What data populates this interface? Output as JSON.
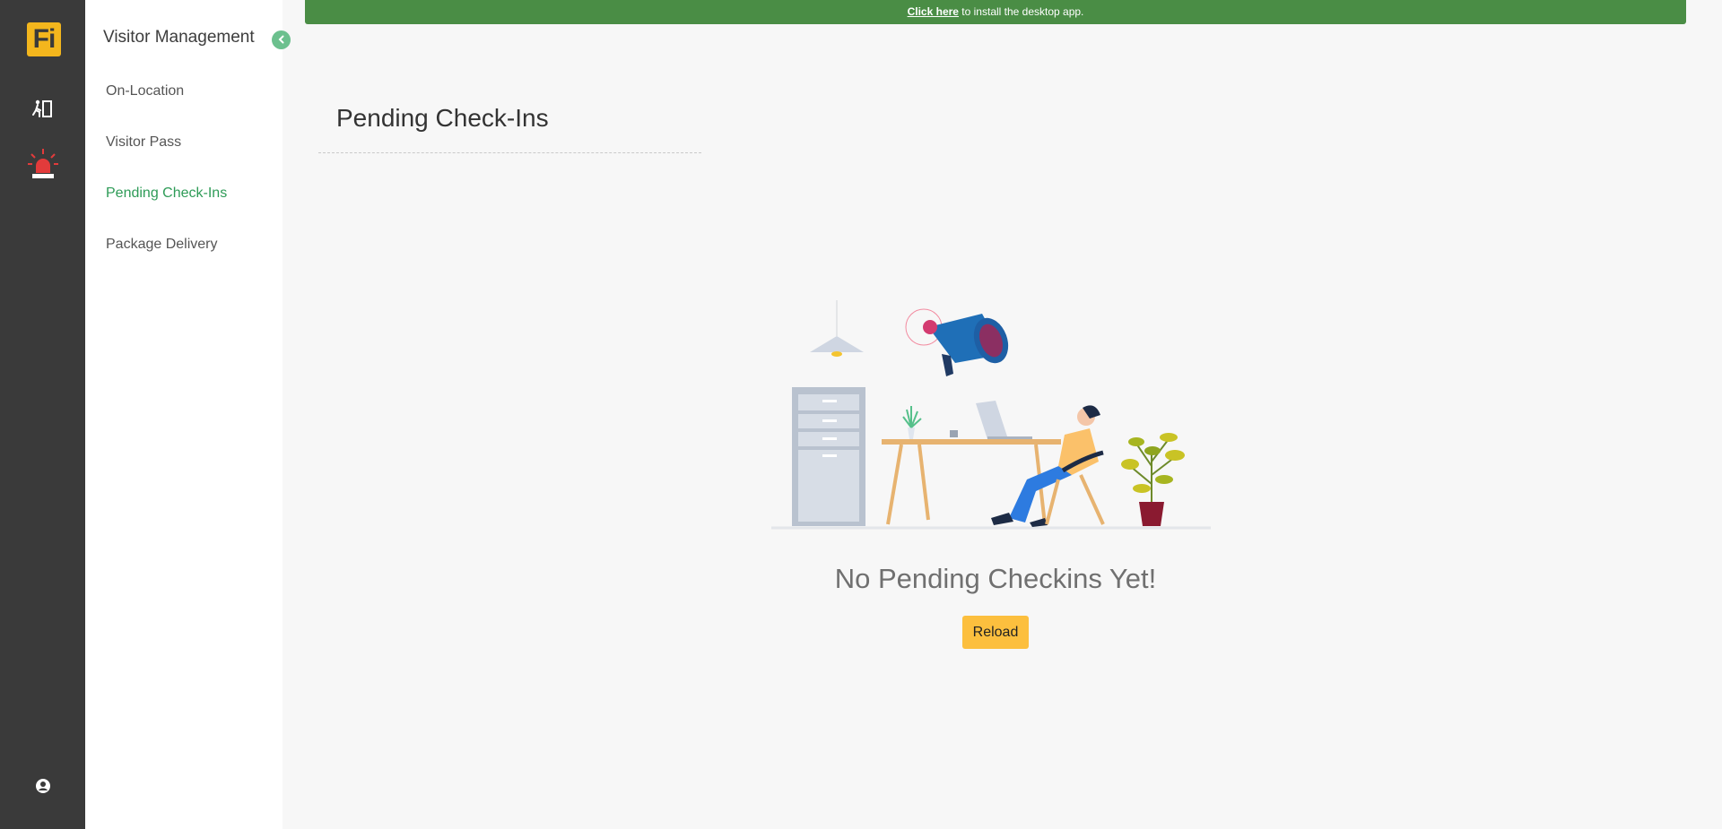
{
  "rail": {
    "logo_text": "Fi",
    "icons": [
      "exit-door-icon",
      "emergency-alarm-icon",
      "user-profile-icon"
    ]
  },
  "sidebar": {
    "title": "Visitor Management",
    "items": [
      {
        "label": "On-Location",
        "active": false
      },
      {
        "label": "Visitor Pass",
        "active": false
      },
      {
        "label": "Pending Check-Ins",
        "active": true
      },
      {
        "label": "Package Delivery",
        "active": false
      }
    ]
  },
  "banner": {
    "link_text": "Click here",
    "message": " to install the desktop app."
  },
  "main": {
    "page_title": "Pending Check-Ins",
    "empty_message": "No Pending Checkins Yet!",
    "reload_label": "Reload"
  },
  "colors": {
    "rail_bg": "#3a3a3a",
    "brand_yellow": "#f3b61d",
    "active_green": "#2e9b57",
    "banner_green": "#4a8d45",
    "button_yellow": "#fcbf3e",
    "alarm_red": "#e23b3b"
  }
}
